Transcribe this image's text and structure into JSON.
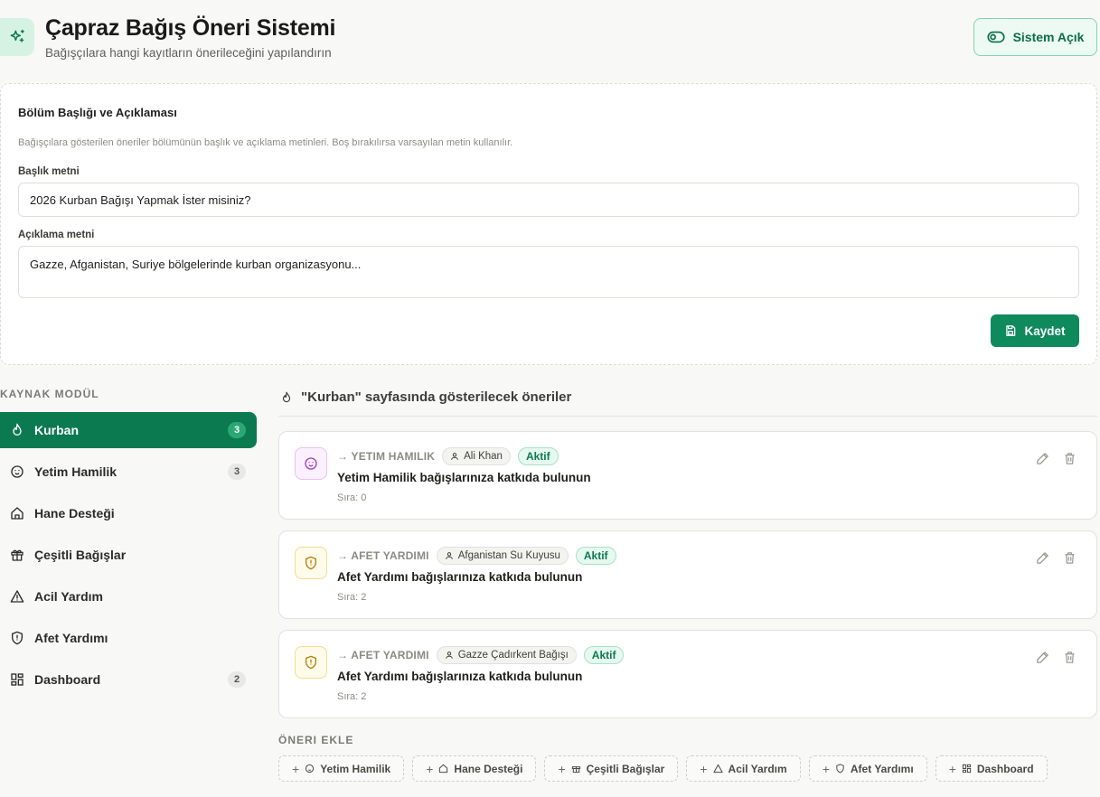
{
  "header": {
    "title": "Çapraz Bağış Öneri Sistemi",
    "subtitle": "Bağışçılara hangi kayıtların önerileceğini yapılandırın",
    "toggle_label": "Sistem Açık",
    "icon": "sparkles-icon"
  },
  "section": {
    "title": "Bölüm Başlığı ve Açıklaması",
    "description": "Bağışçılara gösterilen öneriler bölümünün başlık ve açıklama metinleri. Boş bırakılırsa varsayılan metin kullanılır.",
    "title_label": "Başlık metni",
    "title_value": "2026 Kurban Bağışı Yapmak İster misiniz?",
    "desc_label": "Açıklama metni",
    "desc_value": "Gazze, Afganistan, Suriye bölgelerinde kurban organizasyonu...",
    "save_label": "Kaydet"
  },
  "sidebar": {
    "heading": "KAYNAK MODÜL",
    "items": [
      {
        "label": "Kurban",
        "count": "3",
        "icon": "flame-icon",
        "active": true
      },
      {
        "label": "Yetim Hamilik",
        "count": "3",
        "icon": "baby-icon"
      },
      {
        "label": "Hane Desteği",
        "count": "",
        "icon": "home-icon"
      },
      {
        "label": "Çeşitli Bağışlar",
        "count": "",
        "icon": "gift-icon"
      },
      {
        "label": "Acil Yardım",
        "count": "",
        "icon": "warning-icon"
      },
      {
        "label": "Afet Yardımı",
        "count": "",
        "icon": "shield-icon"
      },
      {
        "label": "Dashboard",
        "count": "2",
        "icon": "grid-icon"
      }
    ]
  },
  "panel": {
    "heading_module": "\"Kurban\"",
    "heading_rest": " sayfasında gösterilecek öneriler"
  },
  "recommendations": [
    {
      "target": "→ YETIM HAMILIK",
      "source": "Ali Khan",
      "status": "Aktif",
      "title": "Yetim Hamilik bağışlarınıza katkıda bulunun",
      "order": "Sıra: 0",
      "icon": "baby-icon"
    },
    {
      "target": "→ AFET YARDIMI",
      "source": "Afganistan Su Kuyusu",
      "status": "Aktif",
      "title": "Afet Yardımı bağışlarınıza katkıda bulunun",
      "order": "Sıra: 2",
      "icon": "shield-alert-icon"
    },
    {
      "target": "→ AFET YARDIMI",
      "source": "Gazze Çadırkent Bağışı",
      "status": "Aktif",
      "title": "Afet Yardımı bağışlarınıza katkıda bulunun",
      "order": "Sıra: 2",
      "icon": "shield-alert-icon"
    }
  ],
  "add": {
    "heading": "ÖNERI EKLE",
    "chips": [
      {
        "label": "Yetim Hamilik",
        "icon": "baby-icon"
      },
      {
        "label": "Hane Desteği",
        "icon": "home-icon"
      },
      {
        "label": "Çeşitli Bağışlar",
        "icon": "gift-icon"
      },
      {
        "label": "Acil Yardım",
        "icon": "warning-icon"
      },
      {
        "label": "Afet Yardımı",
        "icon": "shield-icon"
      },
      {
        "label": "Dashboard",
        "icon": "grid-icon"
      }
    ]
  },
  "colors": {
    "accent": "#0c7a50",
    "accent_light": "#ecfaf3",
    "background": "#f8f8f6"
  }
}
